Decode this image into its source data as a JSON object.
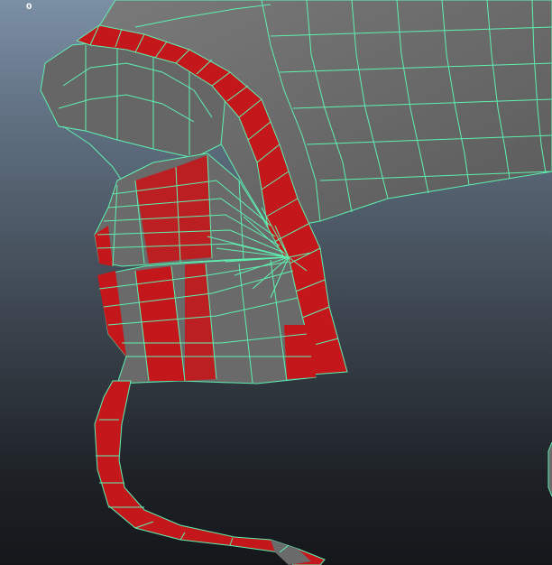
{
  "viewport": {
    "frame_counter": "0",
    "wire_color": "#5ff0b0",
    "face_gray": "#6a6a6a",
    "face_red": "#c4171b"
  }
}
